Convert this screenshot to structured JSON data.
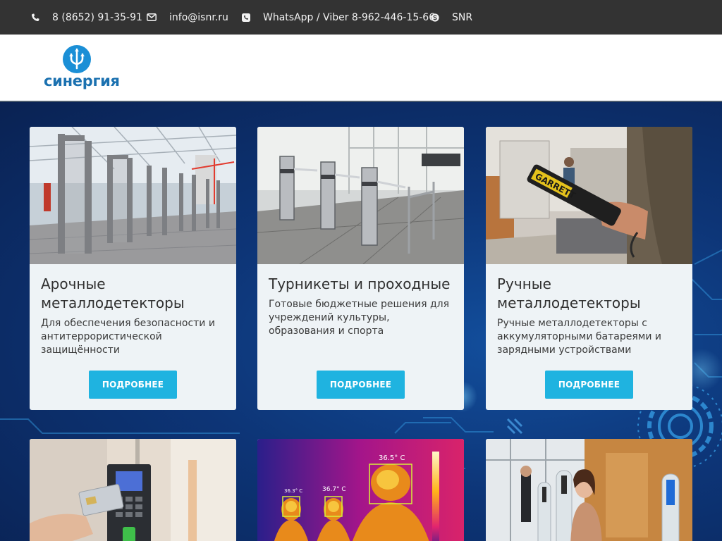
{
  "topbar": {
    "phone": "8 (8652) 91-35-91",
    "email": "info@isnr.ru",
    "whatsapp": "WhatsApp / Viber 8-962-446-15-66",
    "skype": "SNR"
  },
  "header": {
    "logo_text": "синергия"
  },
  "cards": [
    {
      "title": "Арочные металлодетекторы",
      "description": "Для обеспечения безопасности и антитеррористической защищённости",
      "button": "ПОДРОБНЕЕ"
    },
    {
      "title": "Турникеты и проходные",
      "description": "Готовые бюджетные решения для учреждений культуры, образования и спорта",
      "button": "ПОДРОБНЕЕ"
    },
    {
      "title": "Ручные металлодетекторы",
      "description": "Ручные металлодетекторы с аккумуляторными батареями и зарядными устройствами",
      "button": "ПОДРОБНЕЕ"
    },
    {
      "title": "",
      "description": "",
      "button": ""
    },
    {
      "title": "",
      "description": "",
      "button": "",
      "temps": [
        "36.5° C",
        "36.3° C",
        "36.7° C"
      ]
    },
    {
      "title": "",
      "description": "",
      "button": ""
    }
  ],
  "images": {
    "card1": "arch metal detectors",
    "card2": "tripod turnstiles",
    "card3": "hand-held metal detector",
    "card4": "card access control reader",
    "card5": "thermal imaging camera",
    "card6": "face recognition terminal"
  },
  "colors": {
    "topbar": "#333333",
    "accent": "#1fb3e0",
    "background": "#0d3577",
    "logo": "#1b71b0"
  }
}
